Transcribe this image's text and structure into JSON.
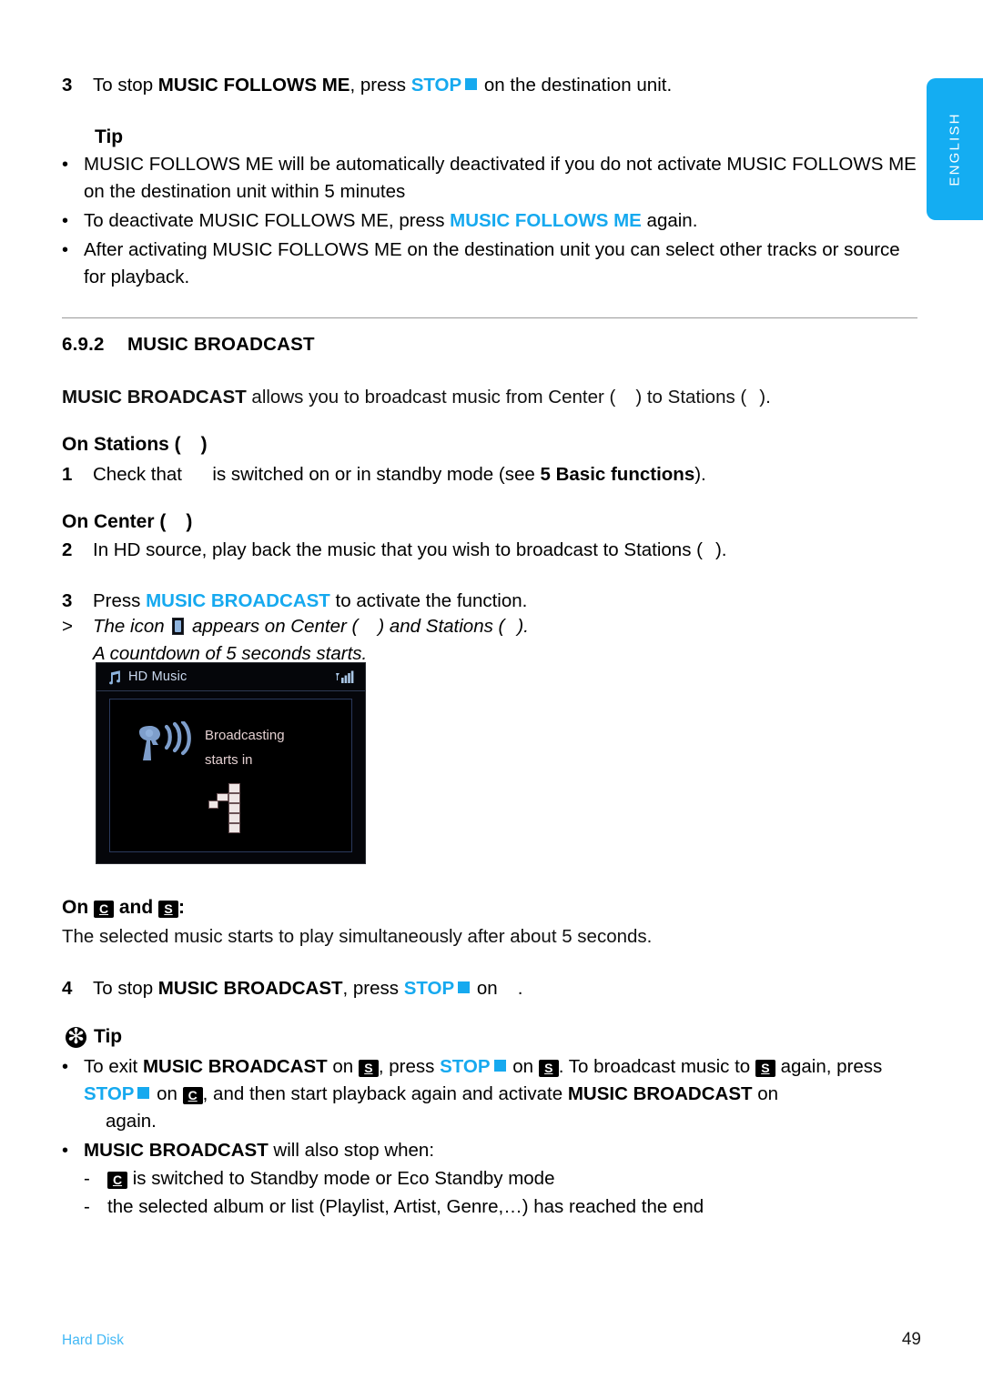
{
  "language_tab": {
    "label": "ENGLISH",
    "color": "#14ADF2"
  },
  "accent_color": "#16A9EF",
  "step3_mfm": {
    "number": "3",
    "pre": "To stop ",
    "bold": "MUSIC FOLLOWS ME",
    "mid": ", press ",
    "key": "STOP",
    "post": " on the destination unit."
  },
  "tip_top": {
    "heading": "Tip",
    "bullets": [
      {
        "text": "MUSIC FOLLOWS ME will be automatically deactivated if you do not activate MUSIC FOLLOWS ME on the destination unit within 5 minutes"
      },
      {
        "pre": "To deactivate MUSIC FOLLOWS ME, press ",
        "key": "MUSIC FOLLOWS ME",
        "post": " again."
      },
      {
        "text": "After activating MUSIC FOLLOWS ME on the destination unit you can select other tracks or source for playback."
      }
    ]
  },
  "section": {
    "number": "6.9.2",
    "title": "MUSIC BROADCAST",
    "intro": {
      "bold": "MUSIC BROADCAST",
      "p1": " allows you to broadcast music from Center (",
      "p2": ") to Stations (",
      "p3": ")."
    }
  },
  "on_stations": {
    "heading_pre": "On Stations (",
    "heading_post": ")",
    "step": {
      "number": "1",
      "pre": "Check that ",
      "mid": " is switched on or in standby mode (see ",
      "bold": "5 Basic functions",
      "post": ")."
    }
  },
  "on_center": {
    "heading_pre": "On Center (",
    "heading_post": ")",
    "step2": {
      "number": "2",
      "pre": "In HD source, play back the music that you wish to broadcast to Stations (",
      "post": ")."
    },
    "step3": {
      "number": "3",
      "pre": "Press ",
      "key": "MUSIC BROADCAST",
      "post": " to activate the function."
    },
    "result": {
      "marker": ">",
      "pre": "The icon ",
      "mid": " appears on Center (",
      "mid2": ") and Stations (",
      "post": ").",
      "line2": "A countdown of 5 seconds starts."
    }
  },
  "lcd": {
    "title": "HD Music",
    "music_note_icon": "music-note-icon",
    "signal_icon": "signal-bars-icon",
    "broadcast_icon": "broadcast-dish-icon",
    "message_line1": "Broadcasting",
    "message_line2": "starts in",
    "countdown": "1"
  },
  "on_cs": {
    "heading_pre": "On ",
    "badge_c": "C",
    "heading_mid": " and ",
    "badge_s": "S",
    "heading_post": ":",
    "body": "The selected music starts to play simultaneously after about 5 seconds."
  },
  "step4": {
    "number": "4",
    "pre": "To stop ",
    "bold": "MUSIC BROADCAST",
    "mid": ", press ",
    "key": "STOP",
    "post": " on",
    "end": "."
  },
  "tip_bottom": {
    "heading": "Tip",
    "icon": "tip-asterisk-icon",
    "bullet1": {
      "t1": "To exit ",
      "b1": "MUSIC BROADCAST",
      "t2": " on ",
      "badge1": "S",
      "t3": ", press ",
      "key1": "STOP",
      "t4": " on ",
      "badge2": "S",
      "t5": ". To broadcast music to ",
      "badge3": "S",
      "t6": " again, press ",
      "key2": "STOP",
      "t7": " on ",
      "badge4": "C",
      "t8": ", and then start playback again and activate ",
      "b2": "MUSIC BROADCAST",
      "t9": " on",
      "t10": "again."
    },
    "bullet2": {
      "bold": "MUSIC BROADCAST",
      "text": " will also stop when:"
    },
    "sub_items": [
      {
        "badge": "C",
        "text": " is switched to Standby mode or Eco Standby mode"
      },
      {
        "badge": "",
        "text": "the selected album or list (Playlist, Artist, Genre,…) has reached the end"
      }
    ]
  },
  "footer": {
    "left": "Hard Disk",
    "page": "49"
  }
}
